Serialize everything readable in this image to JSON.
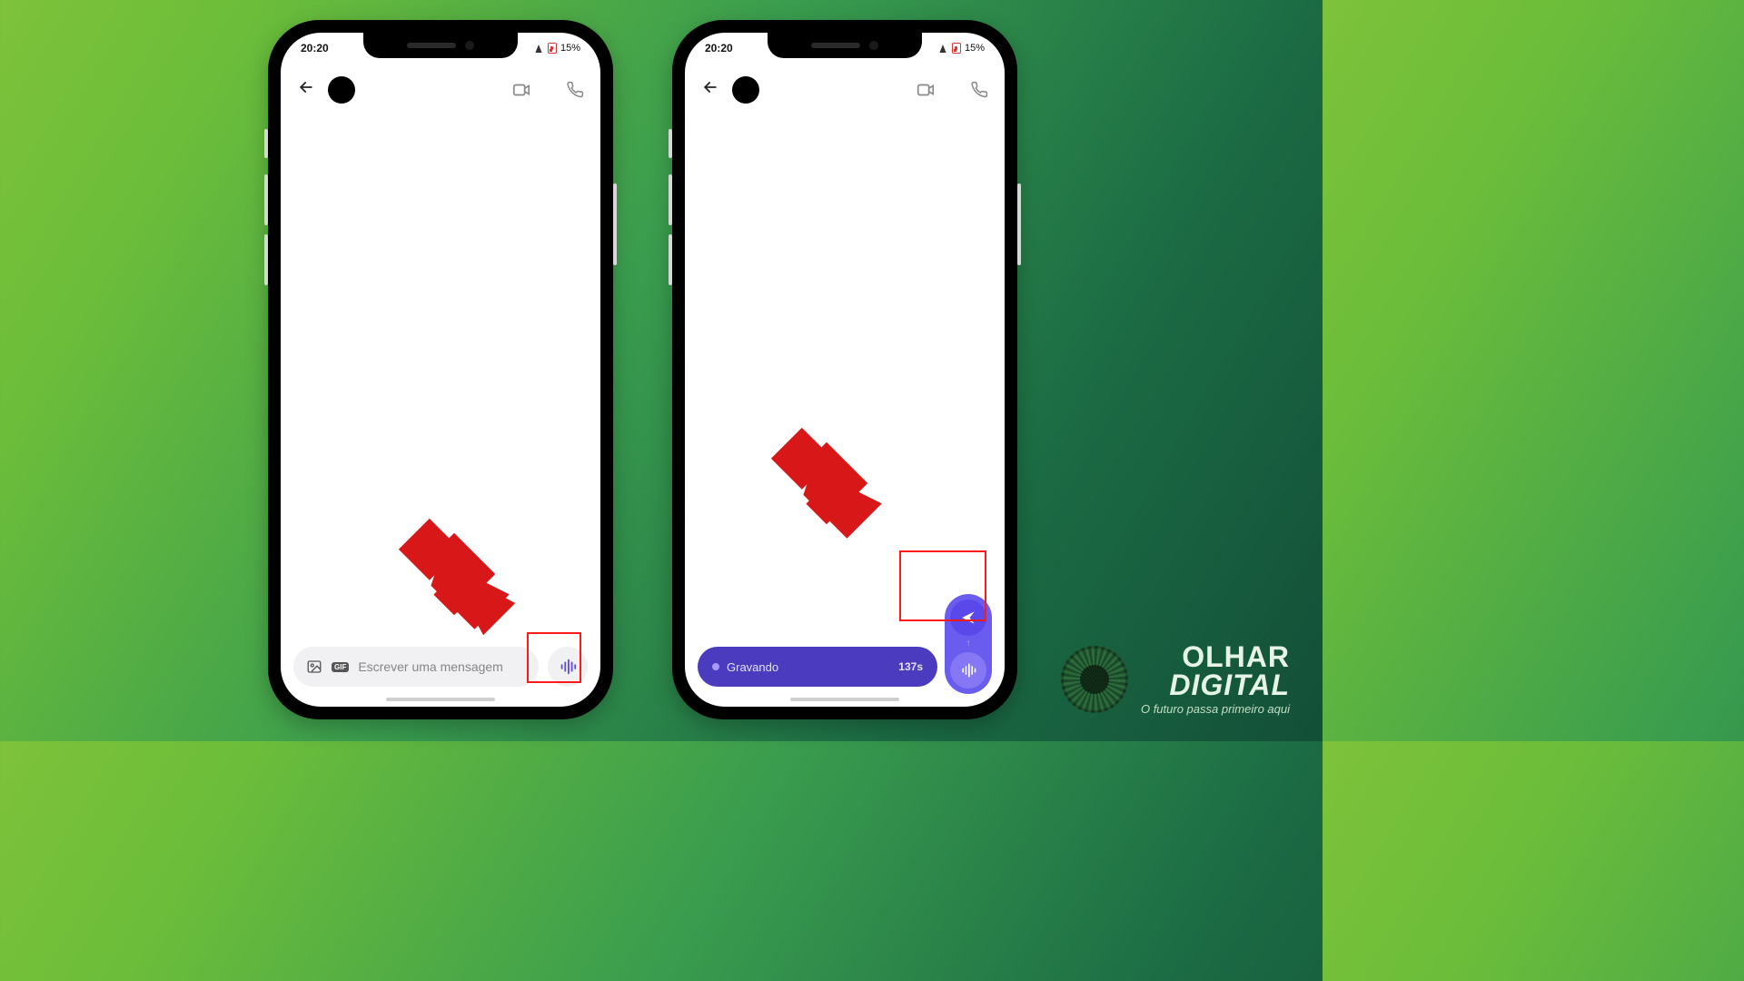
{
  "status": {
    "time": "20:20",
    "battery": "15%"
  },
  "chat_header": {
    "back_icon": "arrow-left",
    "video_icon": "video-call",
    "call_icon": "phone-call"
  },
  "composer_left": {
    "image_icon": "image",
    "gif_label": "GIF",
    "placeholder": "Escrever uma mensagem",
    "voice_icon": "voice-wave"
  },
  "composer_right": {
    "recording_label": "Gravando",
    "recording_time": "137s",
    "send_icon": "send",
    "voice_icon": "voice-wave"
  },
  "brand": {
    "name_top": "OLHAR",
    "name_bottom": "DIGITAL",
    "tagline": "O futuro passa primeiro aqui"
  },
  "colors": {
    "accent_purple": "#5a48ea",
    "arrow_red": "#d81818"
  }
}
